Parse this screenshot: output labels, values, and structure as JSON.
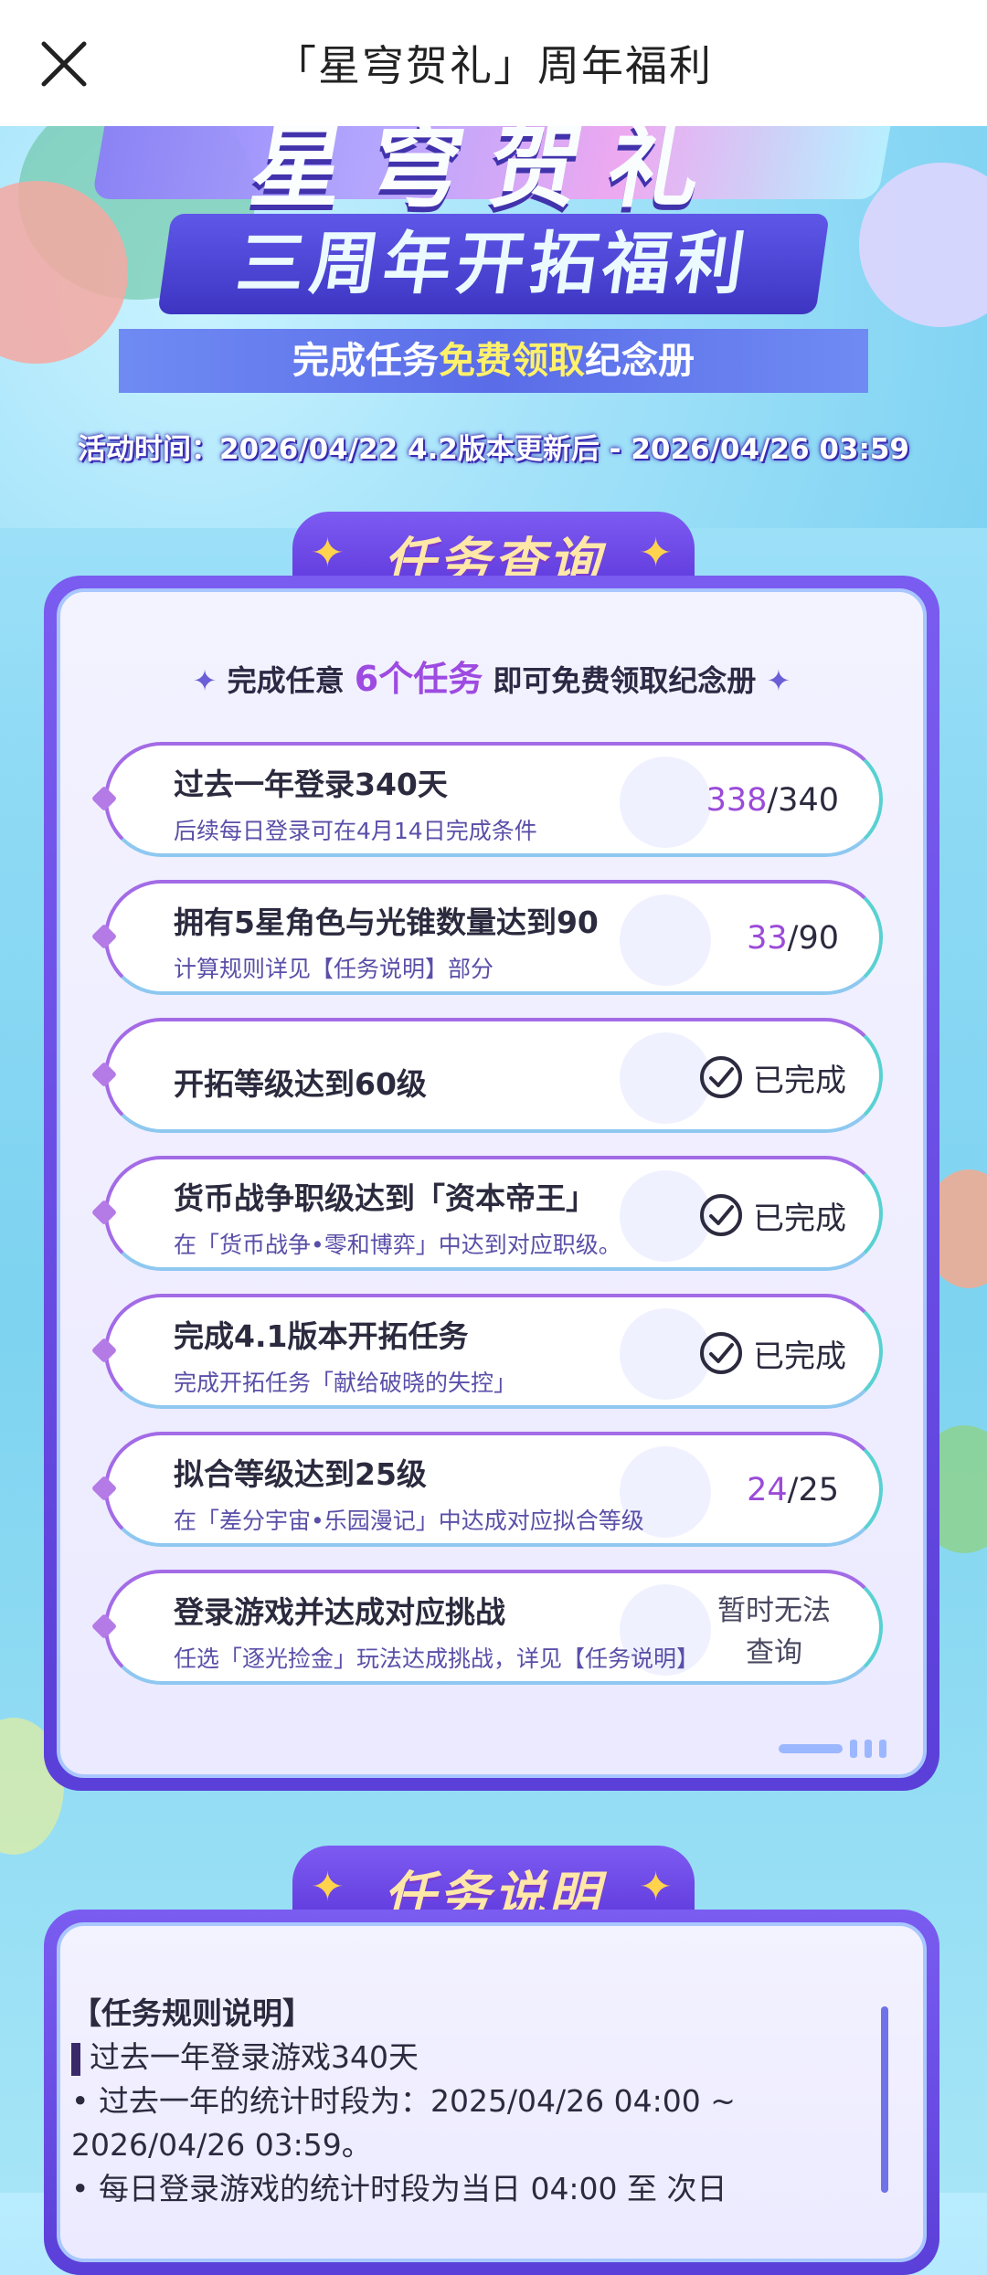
{
  "topbar": {
    "title": "「星穹贺礼」周年福利"
  },
  "banner": {
    "headline": "星穹贺礼",
    "subheadline": "三周年开拓福利",
    "ribbon_prefix": "完成任务",
    "ribbon_highlight": "免费领取",
    "ribbon_suffix": "纪念册",
    "activity_time": "活动时间：2026/04/22 4.2版本更新后 - 2026/04/26 03:59"
  },
  "query_section": {
    "heading": "任务查询",
    "hint_prefix": "完成任意",
    "hint_emph": "6个任务",
    "hint_suffix": "即可免费领取纪念册",
    "tasks": [
      {
        "title": "过去一年登录340天",
        "desc": "后续每日登录可在4月14日完成条件",
        "current": "338",
        "total": "/340"
      },
      {
        "title": "拥有5星角色与光锥数量达到90",
        "desc": "计算规则详见【任务说明】部分",
        "current": "33",
        "total": "/90"
      },
      {
        "title": "开拓等级达到60级",
        "status": "已完成"
      },
      {
        "title": "货币战争职级达到「资本帝王」",
        "desc": "在「货币战争•零和博弈」中达到对应职级。",
        "status": "已完成"
      },
      {
        "title": "完成4.1版本开拓任务",
        "desc": "完成开拓任务「献给破晓的失控」",
        "status": "已完成"
      },
      {
        "title": "拟合等级达到25级",
        "desc": "在「差分宇宙•乐园漫记」中达成对应拟合等级",
        "current": "24",
        "total": "/25"
      },
      {
        "title": "登录游戏并达成对应挑战",
        "desc": "任选「逐光捡金」玩法达成挑战，详见【任务说明】",
        "status_line1": "暂时无法",
        "status_line2": "查询"
      }
    ]
  },
  "rules_section": {
    "heading": "任务说明",
    "rule_title": "【任务规则说明】",
    "item_title": "过去一年登录游戏340天",
    "line1": "• 过去一年的统计时段为：2025/04/26 04:00 ~",
    "line2": "2026/04/26 03:59。",
    "line3": "• 每日登录游戏的统计时段为当日 04:00 至 次日"
  }
}
